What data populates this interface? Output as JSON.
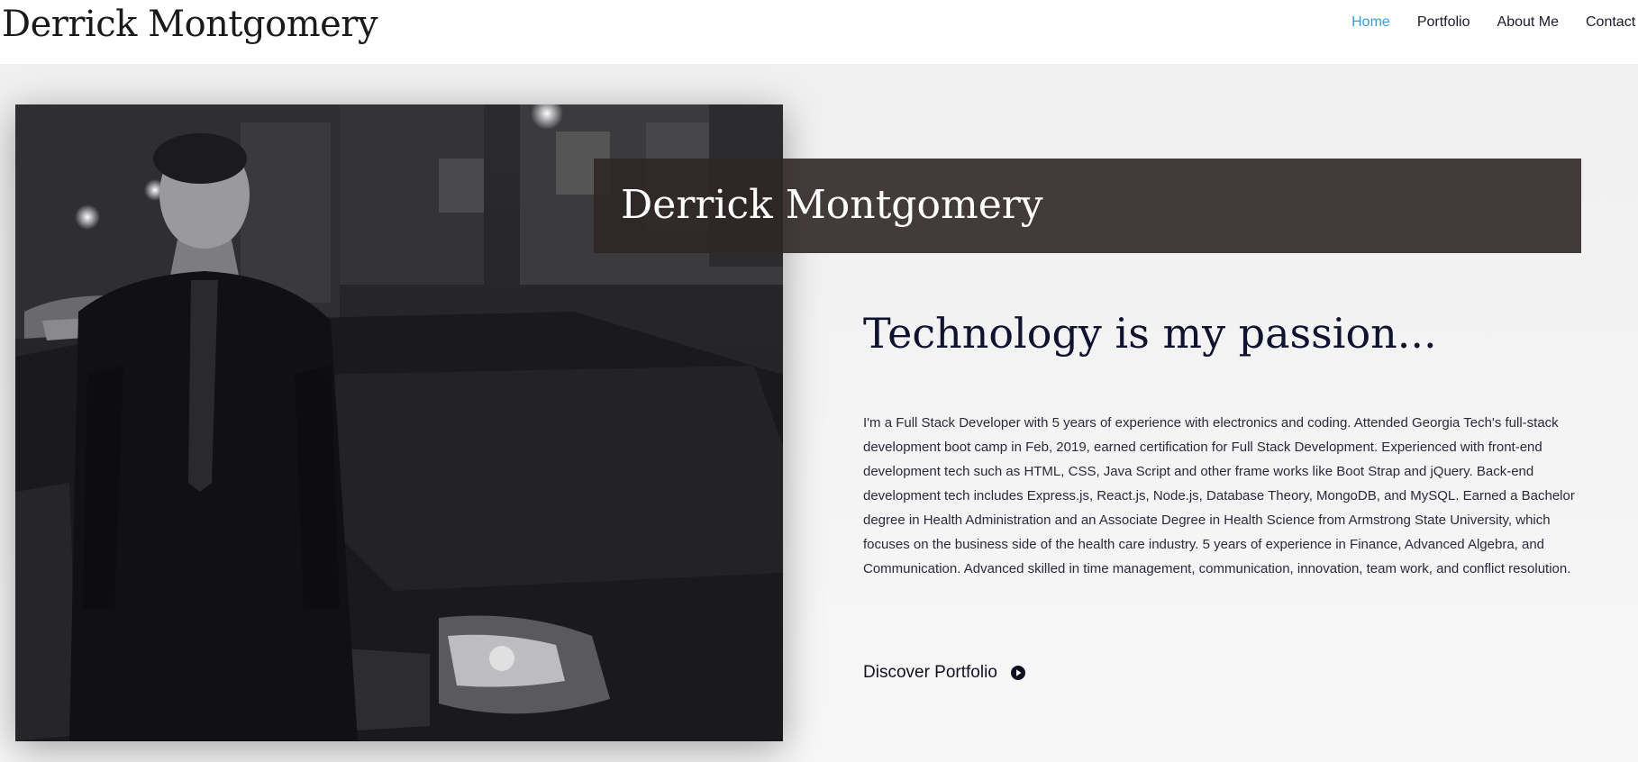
{
  "header": {
    "site_title": "Derrick Montgomery",
    "nav": [
      {
        "label": "Home",
        "active": true
      },
      {
        "label": "Portfolio",
        "active": false
      },
      {
        "label": "About Me",
        "active": false
      },
      {
        "label": "Contact",
        "active": false
      }
    ],
    "active_color": "#3a9bdc"
  },
  "hero": {
    "photo_icon": "portrait-photo",
    "banner_name": "Derrick Montgomery",
    "banner_color": "#302626",
    "headline": "Technology is my passion...",
    "bio": " I'm a Full Stack Developer with 5 years of experience with electronics and coding. Attended Georgia Tech's full-stack development boot camp in Feb, 2019, earned certification for Full Stack Development. Experienced with front-end development tech such as HTML, CSS, Java Script and other frame works like Boot Strap and jQuery. Back-end development tech includes Express.js, React.js, Node.js, Database Theory, MongoDB, and MySQL. Earned a Bachelor degree in Health Administration and an Associate Degree in Health Science from Armstrong State University, which focuses on the business side of the health care industry. 5 years of experience in Finance, Advanced Algebra, and Communication. Advanced skilled in time management, communication, innovation, team work, and conflict resolution.",
    "cta_label": "Discover Portfolio",
    "cta_icon": "play-circle-icon"
  }
}
